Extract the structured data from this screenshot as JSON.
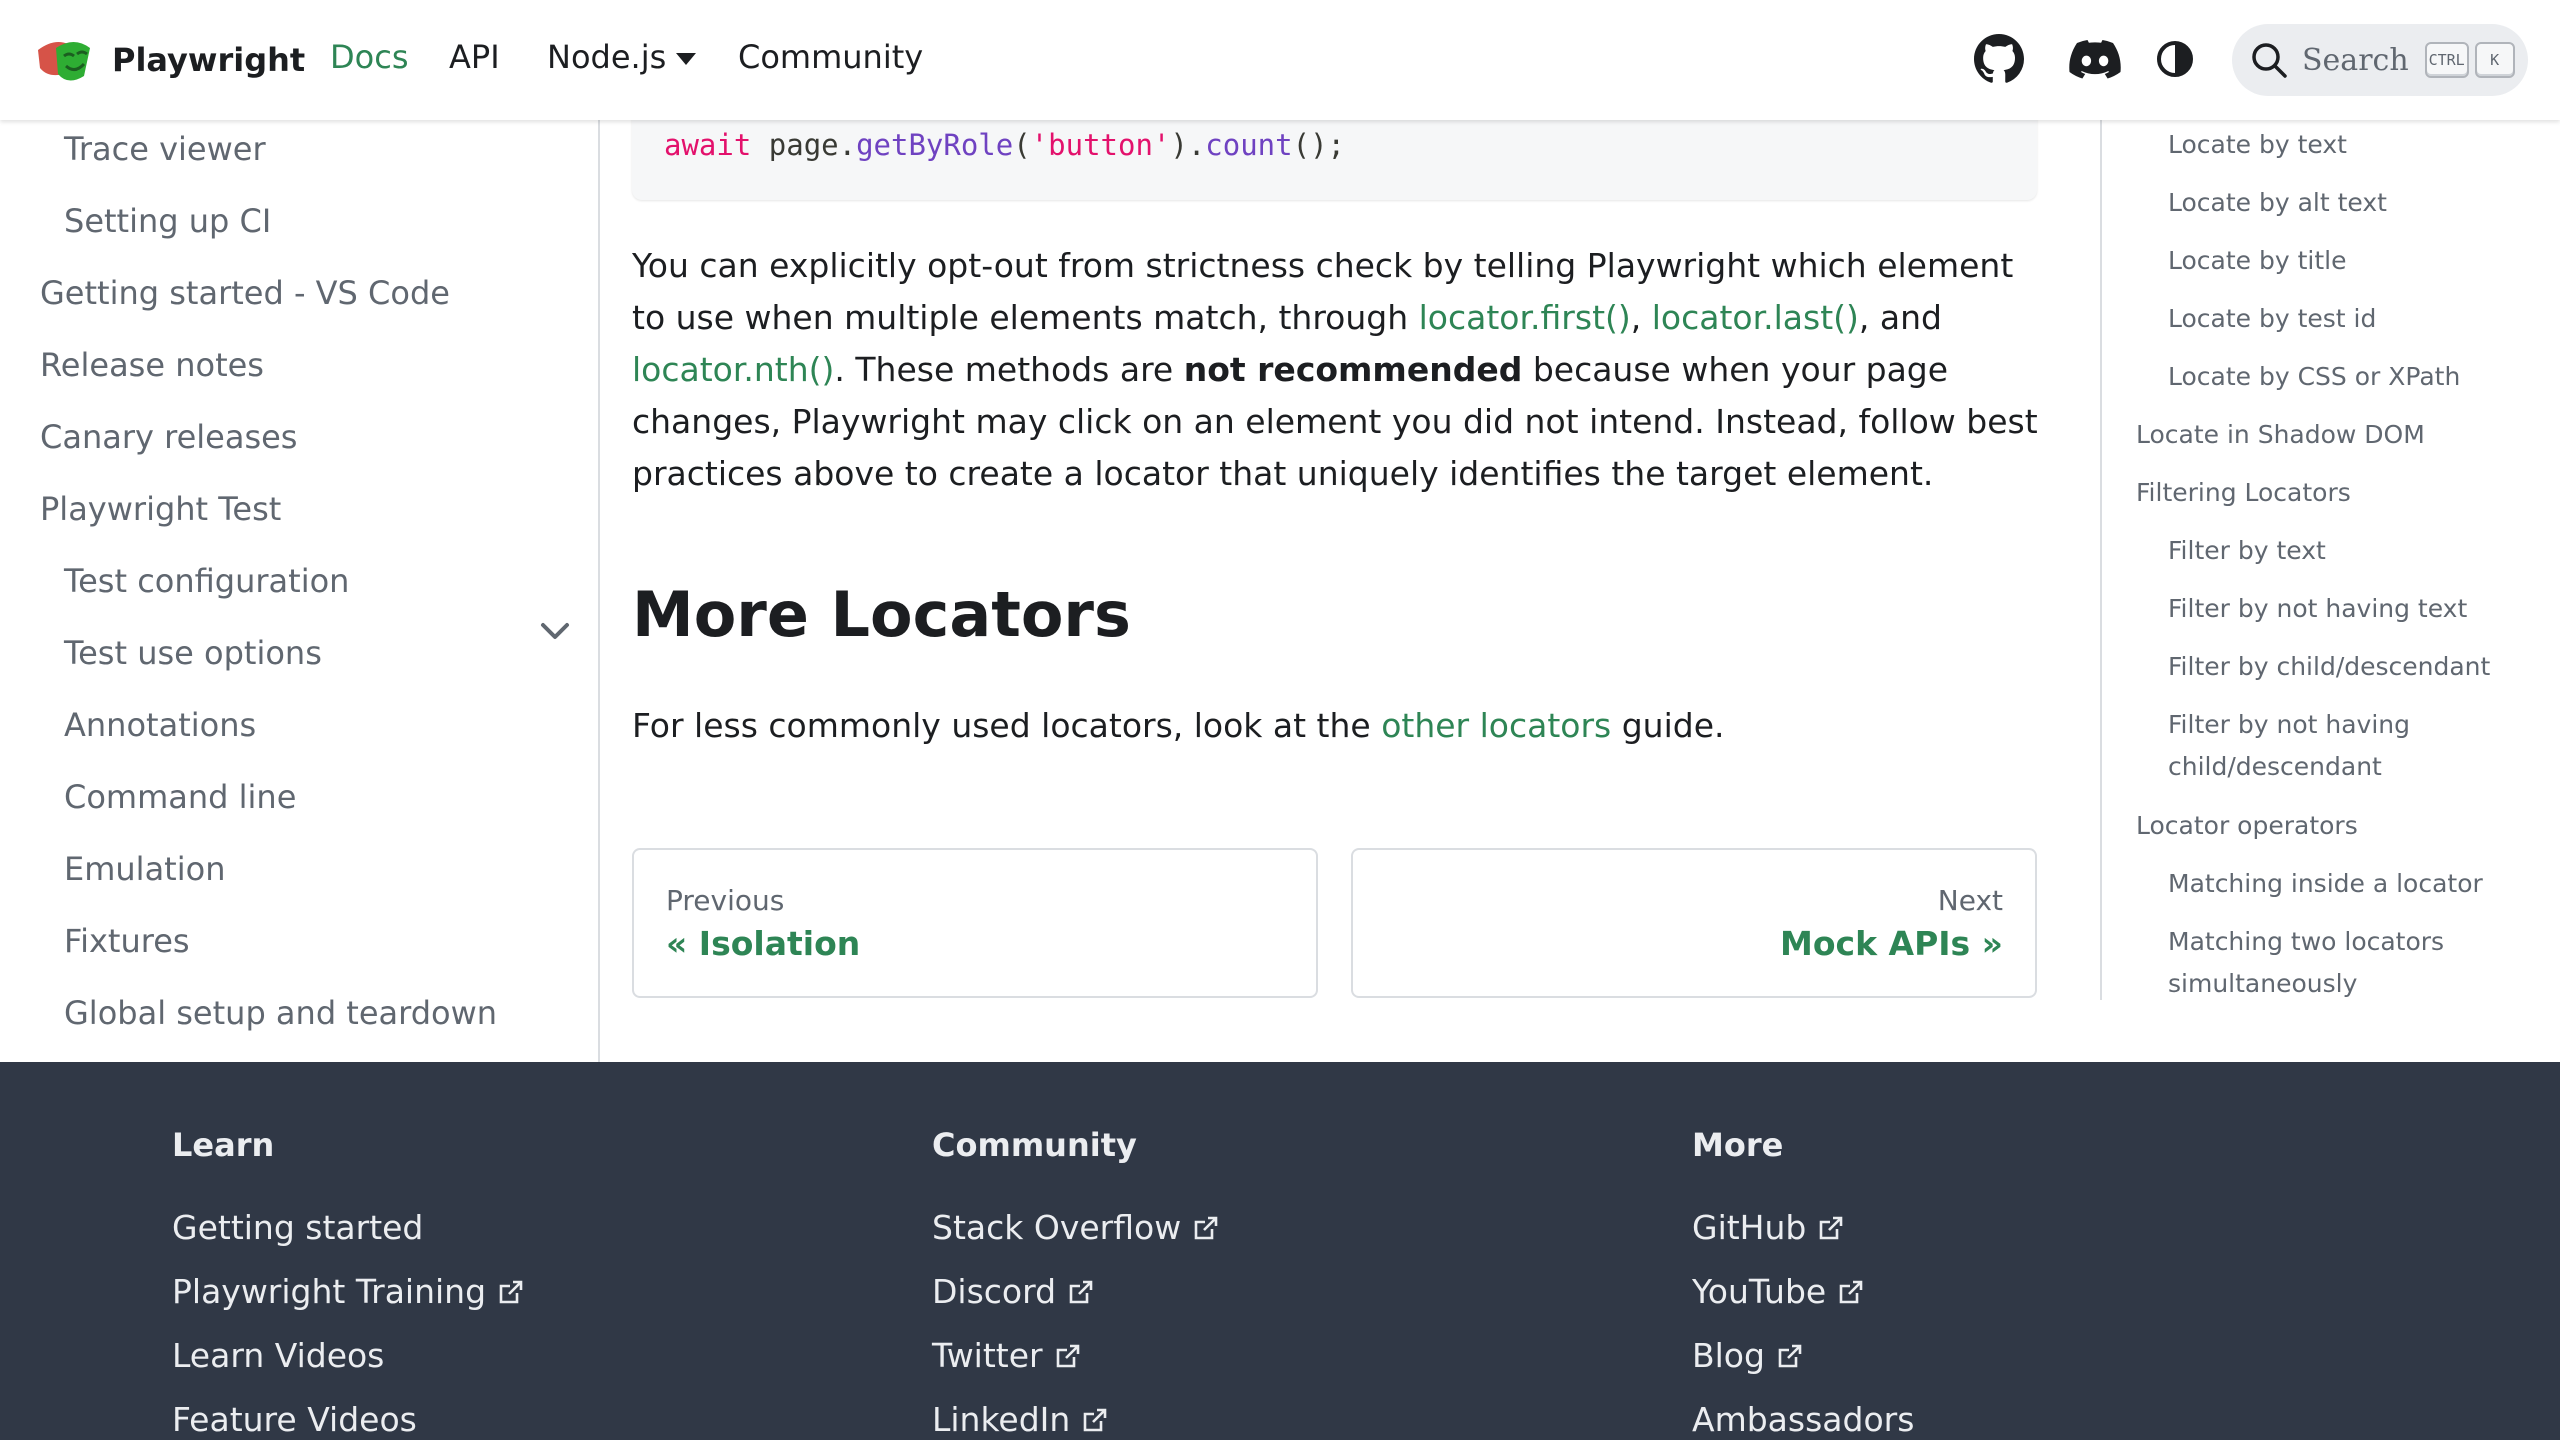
{
  "navbar": {
    "brand": "Playwright",
    "links": [
      {
        "label": "Docs",
        "active": true
      },
      {
        "label": "API"
      },
      {
        "label": "Node.js"
      },
      {
        "label": "Community"
      }
    ],
    "icons": [
      "github-icon",
      "discord-icon",
      "theme-toggle-icon"
    ],
    "search": {
      "placeholder": "Search",
      "key1": "CTRL",
      "key2": "K"
    }
  },
  "sidebar": {
    "items": [
      {
        "label": "Trace viewer"
      },
      {
        "label": "Setting up CI"
      },
      {
        "label": "Getting started - VS Code"
      },
      {
        "label": "Release notes"
      },
      {
        "label": "Canary releases"
      },
      {
        "label": "Playwright Test"
      },
      {
        "label": "Test configuration"
      },
      {
        "label": "Test use options"
      },
      {
        "label": "Annotations"
      },
      {
        "label": "Command line"
      },
      {
        "label": "Emulation"
      },
      {
        "label": "Fixtures"
      },
      {
        "label": "Global setup and teardown"
      }
    ]
  },
  "main": {
    "code": {
      "t1": "await",
      "t2": " page.",
      "t3": "getByRole",
      "t4": "(",
      "t5": "'button'",
      "t6": ").",
      "t7": "count",
      "t8": "();"
    },
    "para1": {
      "s1": "You can explicitly opt-out from strictness check by telling Playwright which element to use when multiple elements match, through ",
      "link1": "locator.first()",
      "s2": ", ",
      "link2": "locator.last()",
      "s3": ", and ",
      "link3": "locator.nth()",
      "s4": ". These methods are ",
      "bold": "not recommended",
      "s5": " because when your page changes, Playwright may click on an element you did not intend. Instead, follow best practices above to create a locator that uniquely identifies the target element."
    },
    "heading": "More Locators",
    "para2": {
      "s1": "For less commonly used locators, look at the ",
      "link": "other locators",
      "s2": " guide."
    },
    "pager": {
      "prev_sub": "Previous",
      "prev_title": "« Isolation",
      "next_sub": "Next",
      "next_title": "Mock APIs »"
    }
  },
  "toc": {
    "items": [
      "Locate by text",
      "Locate by alt text",
      "Locate by title",
      "Locate by test id",
      "Locate by CSS or XPath",
      "Locate in Shadow DOM",
      "Filtering Locators",
      "Filter by text",
      "Filter by not having text",
      "Filter by child/descendant",
      "Filter by not having",
      "child/descendant",
      "Locator operators",
      "Matching inside a locator",
      "Matching two locators",
      "simultaneously"
    ]
  },
  "footer": {
    "columns": [
      {
        "title": "Learn",
        "links": [
          "Getting started",
          "Playwright Training",
          "Learn Videos",
          "Feature Videos"
        ]
      },
      {
        "title": "Community",
        "links": [
          "Stack Overflow",
          "Discord",
          "Twitter",
          "LinkedIn"
        ]
      },
      {
        "title": "More",
        "links": [
          "GitHub",
          "YouTube",
          "Blog",
          "Ambassadors"
        ]
      }
    ]
  },
  "colors": {
    "accent": "#2e8555",
    "footer_bg": "#303846",
    "code_keyword": "#e3116c",
    "code_function": "#6f42c1"
  }
}
